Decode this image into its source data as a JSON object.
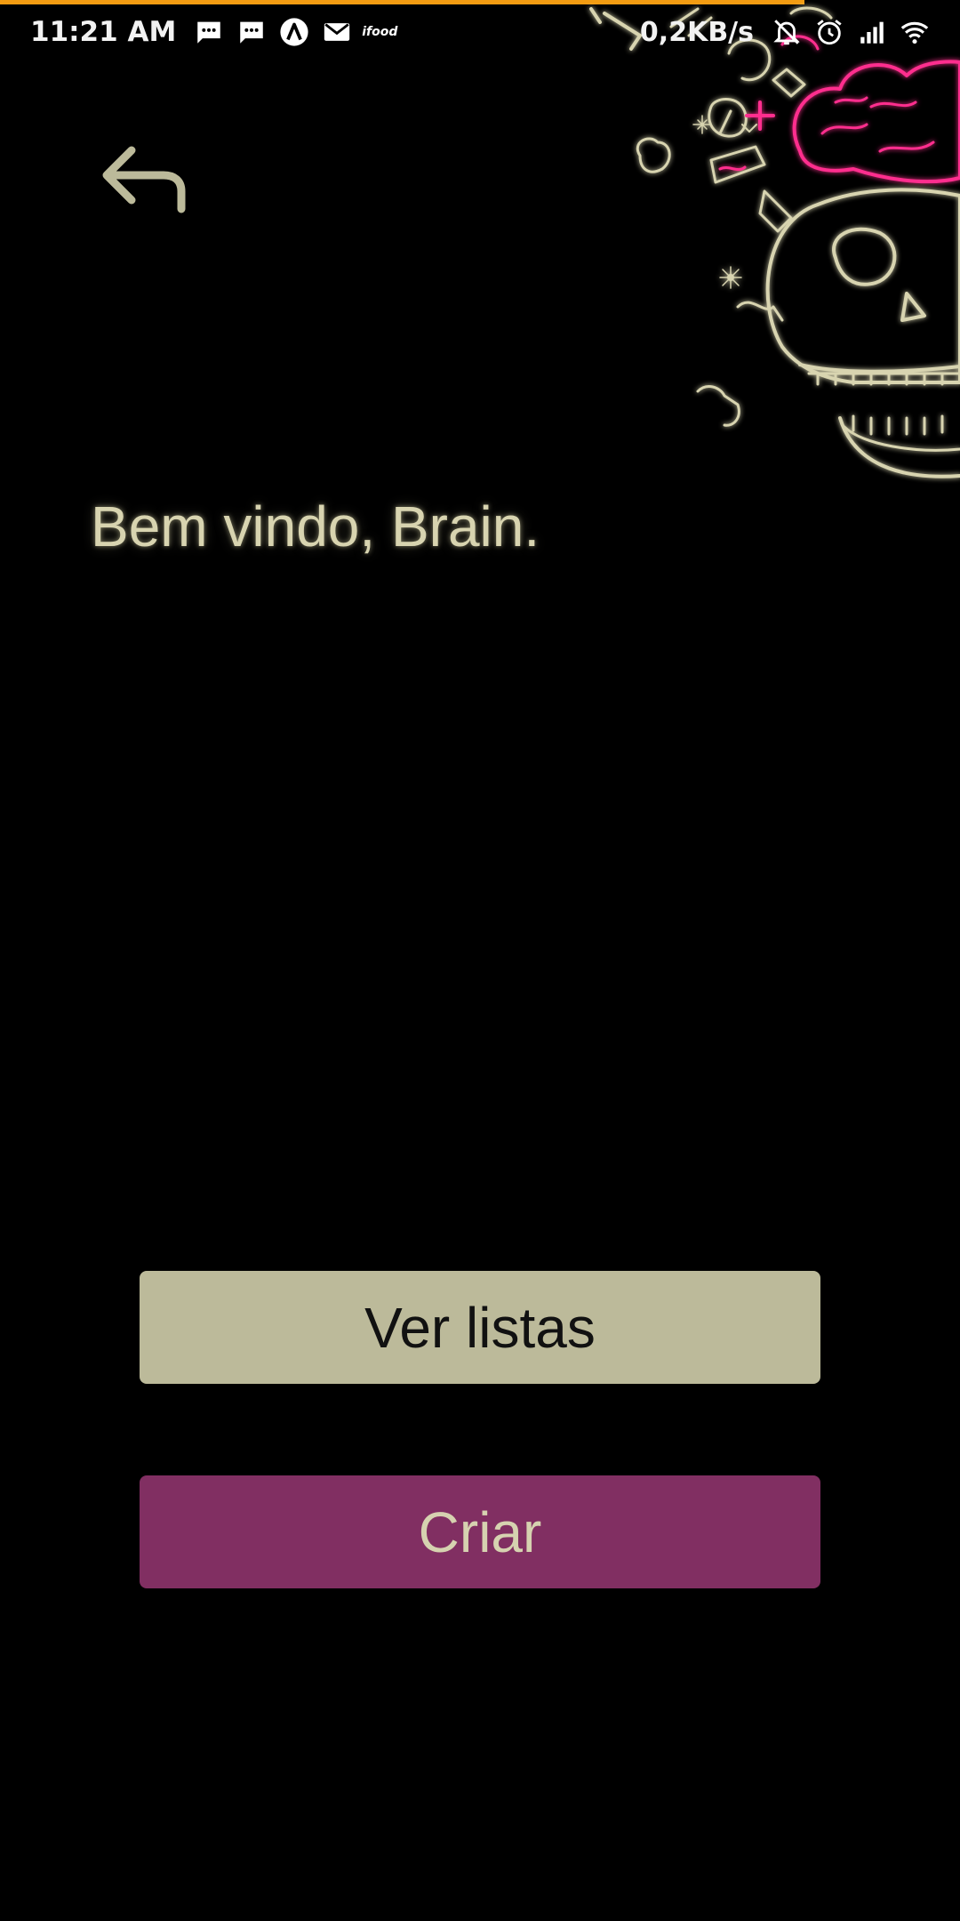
{
  "status_bar": {
    "time": "11:21 AM",
    "net_speed": "0,2KB/s",
    "ifood_label": "ifood",
    "left_icons": [
      "message-icon",
      "message-icon",
      "app-a-icon",
      "gmail-icon",
      "ifood-icon"
    ],
    "right_icons": [
      "bell-off-icon",
      "alarm-icon",
      "signal-icon",
      "wifi-icon"
    ]
  },
  "header": {
    "back_icon": "back-arrow-icon"
  },
  "main": {
    "welcome_text": "Bem vindo, Brain."
  },
  "actions": {
    "view_lists_label": "Ver listas",
    "create_label": "Criar"
  },
  "colors": {
    "background": "#000000",
    "text_accent": "#d8d4b0",
    "button_primary": "#bcba9a",
    "button_secondary": "#812f62",
    "progress": "#f39c12",
    "neon_magenta": "#ff2f8e"
  }
}
